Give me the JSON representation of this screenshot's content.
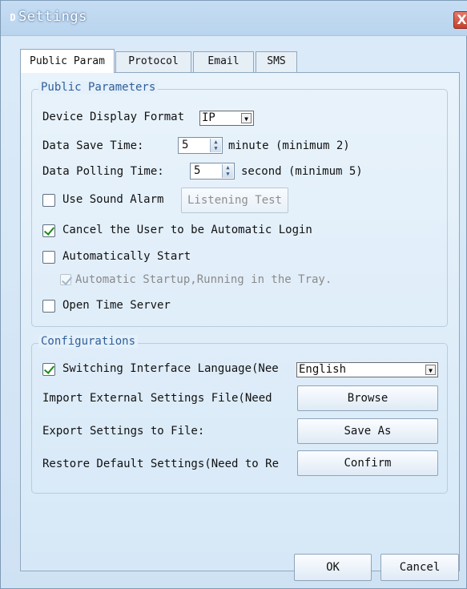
{
  "window": {
    "title": "Settings",
    "close_glyph": "X"
  },
  "tabs": [
    {
      "label": "Public Param",
      "active": true
    },
    {
      "label": "Protocol",
      "active": false
    },
    {
      "label": "Email",
      "active": false
    },
    {
      "label": "SMS",
      "active": false
    }
  ],
  "public": {
    "group_title": "Public Parameters",
    "display_format_label": "Device Display Format",
    "display_format_value": "IP",
    "save_time_label": "Data Save Time:",
    "save_time_value": "5",
    "save_time_unit": "minute (minimum 2)",
    "polling_time_label": "Data Polling Time:",
    "polling_time_value": "5",
    "polling_time_unit": "second (minimum 5)",
    "sound_alarm_label": "Use Sound Alarm",
    "sound_alarm_checked": false,
    "listening_test_label": "Listening Test",
    "cancel_auto_login_label": "Cancel the User to be Automatic Login",
    "cancel_auto_login_checked": true,
    "auto_start_label": "Automatically Start",
    "auto_start_checked": false,
    "tray_label": "Automatic Startup,Running in the Tray.",
    "tray_checked": true,
    "time_server_label": "Open Time Server",
    "time_server_checked": false
  },
  "config": {
    "group_title": "Configurations",
    "switch_lang_label": "Switching Interface Language(Nee",
    "switch_lang_checked": true,
    "language_value": "English",
    "import_label": "Import External Settings File(Need",
    "browse_label": "Browse",
    "export_label": "Export Settings to File:",
    "save_as_label": "Save As",
    "restore_label": "Restore Default Settings(Need to Re",
    "confirm_label": "Confirm"
  },
  "footer": {
    "ok_label": "OK",
    "cancel_label": "Cancel"
  },
  "colors": {
    "title_bar": "#b9d4ee",
    "group_title": "#2f5f9a",
    "check_mark": "#1a8a1a",
    "close_button": "#c4412f"
  }
}
